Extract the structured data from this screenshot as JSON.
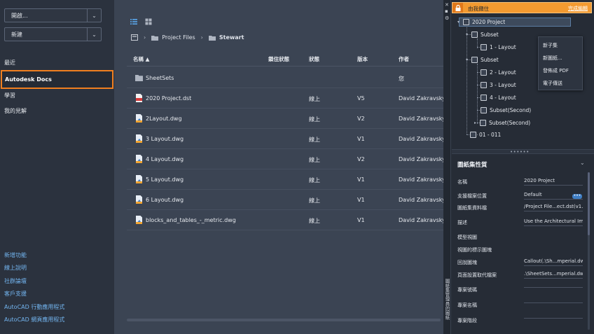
{
  "sidebar": {
    "open_label": "開啟...",
    "new_label": "新建",
    "nav": [
      "最近",
      "Autodesk Docs",
      "學習",
      "我的見解"
    ],
    "links": [
      "新增功能",
      "線上說明",
      "社群論壇",
      "客戶支援",
      "AutoCAD 行動應用程式",
      "AutoCAD 網頁應用程式"
    ]
  },
  "main": {
    "breadcrumb": [
      "Project Files",
      "Stewart"
    ],
    "columns": {
      "name": "名稱",
      "lock": "鎖住狀態",
      "status": "狀態",
      "version": "版本",
      "author": "作者"
    },
    "rows": [
      {
        "name": "SheetSets",
        "lock": "",
        "status": "",
        "version": "",
        "author": "您",
        "icon": "folder-icon"
      },
      {
        "name": "2020 Project.dst",
        "lock": "",
        "status": "線上",
        "version": "V5",
        "author": "David Zakravsky",
        "icon": "dst-file-icon"
      },
      {
        "name": "2Layout.dwg",
        "lock": "",
        "status": "線上",
        "version": "V2",
        "author": "David Zakravsky",
        "icon": "dwg-file-icon"
      },
      {
        "name": "3 Layout.dwg",
        "lock": "",
        "status": "線上",
        "version": "V1",
        "author": "David Zakravsky",
        "icon": "dwg-file-icon"
      },
      {
        "name": "4 Layout.dwg",
        "lock": "",
        "status": "線上",
        "version": "V2",
        "author": "David Zakravsky",
        "icon": "dwg-file-icon"
      },
      {
        "name": "5 Layout.dwg",
        "lock": "",
        "status": "線上",
        "version": "V1",
        "author": "David Zakravsky",
        "icon": "dwg-file-icon"
      },
      {
        "name": "6 Layout.dwg",
        "lock": "",
        "status": "線上",
        "version": "V1",
        "author": "David Zakravsky",
        "icon": "dwg-file-icon"
      },
      {
        "name": "blocks_and_tables_-_metric.dwg",
        "lock": "",
        "status": "線上",
        "version": "V1",
        "author": "David Zakravsky",
        "icon": "dwg-file-icon"
      }
    ]
  },
  "panel": {
    "header_title": "由我擷住",
    "header_action": "完成編輯",
    "tree": {
      "root": "2020 Project",
      "subset1": "Subset",
      "s1_layout": "1 - Layout",
      "subset2": "Subset",
      "s2_layout2": "2 - Layout",
      "s2_layout3": "3 - Layout",
      "s2_layout4": "4 - Layout",
      "subset_second1": "Subset(Second)",
      "subset_second2": "Subset(Second)",
      "item011": "01 - 011"
    },
    "context_menu": [
      "新子集",
      "新圖紙...",
      "發佈成 PDF",
      "電子傳送"
    ],
    "props_title": "圖紙集性質",
    "props": [
      {
        "label": "名稱",
        "value": "2020 Project"
      },
      {
        "label": "支援檔案位置",
        "value": "Default"
      },
      {
        "label": "圖紙集資料檔",
        "value": "/Project File...ect.dst(v1.1)"
      },
      {
        "label": "描述",
        "value": "Use the Architectural Imp"
      },
      {
        "label": "模型視圖",
        "value": ""
      },
      {
        "label": "視圖的標示圖塊",
        "value": ""
      },
      {
        "label": "回說圖塊",
        "value": "Callout(.\\Sh...mperial.dwt)"
      },
      {
        "label": "頁面設置取代檔案",
        "value": ".\\SheetSets...mperial.dwt"
      },
      {
        "label": "專案號碼",
        "value": ""
      },
      {
        "label": "專案名稱",
        "value": ""
      },
      {
        "label": "專案階段",
        "value": ""
      }
    ],
    "vertical_title": "圖紙集管理員的圖紙"
  },
  "colors": {
    "accent_orange": "#f07f1f",
    "link_blue": "#73b5f0",
    "header_orange": "#f39a30"
  }
}
